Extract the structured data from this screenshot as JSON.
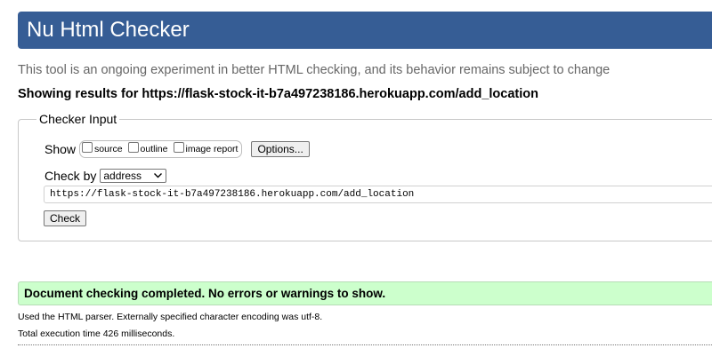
{
  "header": {
    "title": "Nu Html Checker",
    "bg_color": "#365d95"
  },
  "tagline": "This tool is an ongoing experiment in better HTML checking, and its behavior remains subject to change",
  "showing_results": "Showing results for https://flask-stock-it-b7a497238186.herokuapp.com/add_location",
  "checker_input": {
    "legend": "Checker Input",
    "show_label": "Show",
    "options": [
      {
        "label": "source",
        "checked": false
      },
      {
        "label": "outline",
        "checked": false
      },
      {
        "label": "image report",
        "checked": false
      }
    ],
    "options_button": "Options...",
    "check_by_label": "Check by",
    "check_by_value": "address",
    "url_value": "https://flask-stock-it-b7a497238186.herokuapp.com/add_location",
    "check_button": "Check"
  },
  "result": {
    "message": "Document checking completed. No errors or warnings to show.",
    "bg_color": "#ccffcc",
    "parser_note": "Used the HTML parser. Externally specified character encoding was utf-8.",
    "execution_time": "Total execution time 426 milliseconds."
  }
}
